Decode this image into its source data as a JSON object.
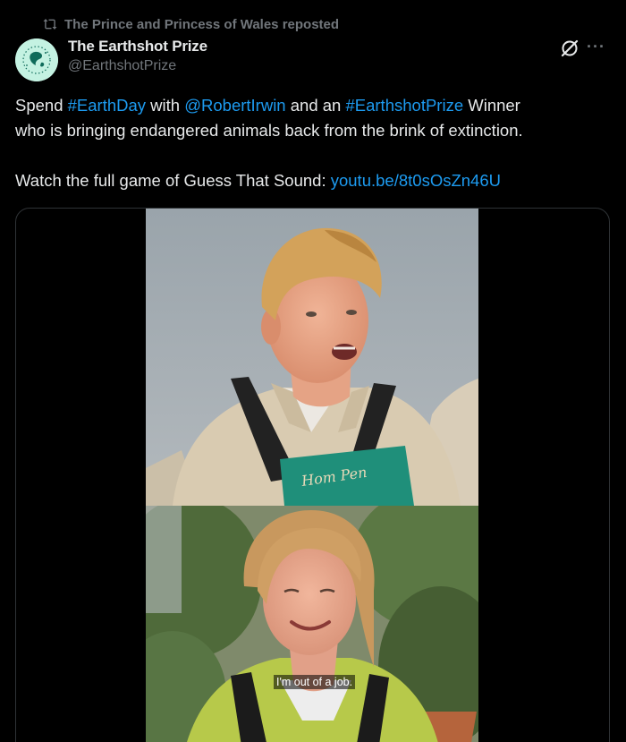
{
  "repost": {
    "icon": "repost-icon",
    "text": "The Prince and Princess of Wales reposted"
  },
  "author": {
    "avatar_icon": "earth-globe-avatar",
    "name": "The Earthshot Prize",
    "handle": "@EarthshotPrize"
  },
  "actions": {
    "grok_icon": "grok-icon",
    "more_icon": "more-icon",
    "more_label": "···"
  },
  "tweet": {
    "line1": {
      "t1": "Spend ",
      "h1": "#EarthDay",
      "t2": " with ",
      "m1": "@RobertIrwin",
      "t3": " and an ",
      "h2": "#EarthshotPrize",
      "t4": " Winner"
    },
    "line2": "who is bringing endangered animals back from the brink of extinction.",
    "line3": {
      "t1": "Watch the full game of Guess That Sound: ",
      "link": "youtu.be/8t0sOsZn46U"
    }
  },
  "media": {
    "apron_text": "Hom Pen",
    "subtitle": "I'm out of a job."
  },
  "colors": {
    "background": "#000000",
    "text": "#e7e9ea",
    "muted": "#71767b",
    "link": "#1d9bf0",
    "border": "#2f3336"
  }
}
